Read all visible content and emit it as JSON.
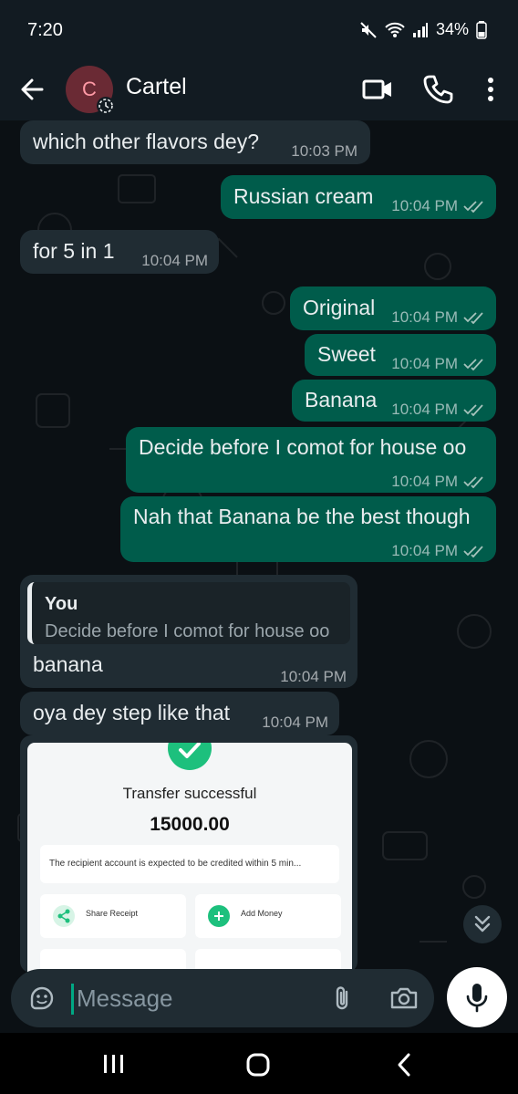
{
  "status_bar": {
    "time": "7:20",
    "battery": "34%"
  },
  "header": {
    "avatar_letter": "C",
    "contact_name": "Cartel"
  },
  "messages": [
    {
      "direction": "in",
      "text": "which other flavors dey?",
      "time": "10:03 PM"
    },
    {
      "direction": "out",
      "text": "Russian cream",
      "time": "10:04 PM"
    },
    {
      "direction": "in",
      "text": "for 5 in 1",
      "time": "10:04 PM"
    },
    {
      "direction": "out",
      "text": "Original",
      "time": "10:04 PM"
    },
    {
      "direction": "out",
      "text": "Sweet",
      "time": "10:04 PM"
    },
    {
      "direction": "out",
      "text": "Banana",
      "time": "10:04 PM"
    },
    {
      "direction": "out",
      "text": "Decide before I comot for house oo",
      "time": "10:04 PM"
    },
    {
      "direction": "out",
      "text": "Nah that Banana be the best though",
      "time": "10:04 PM"
    },
    {
      "direction": "in",
      "text": "banana",
      "time": "10:04 PM",
      "quote_author": "You",
      "quote_text": "Decide before I comot for house oo"
    },
    {
      "direction": "in",
      "text": "oya dey step like that",
      "time": "10:04 PM"
    }
  ],
  "receipt": {
    "title": "Transfer successful",
    "amount": "15000.00",
    "note": "The recipient account is expected to be credited within 5 min...",
    "share_label": "Share Receipt",
    "add_money_label": "Add Money"
  },
  "composer": {
    "placeholder": "Message"
  },
  "colors": {
    "outgoing": "#005c4b",
    "incoming": "#202c33",
    "background": "#0b1014",
    "accent": "#00a884"
  }
}
